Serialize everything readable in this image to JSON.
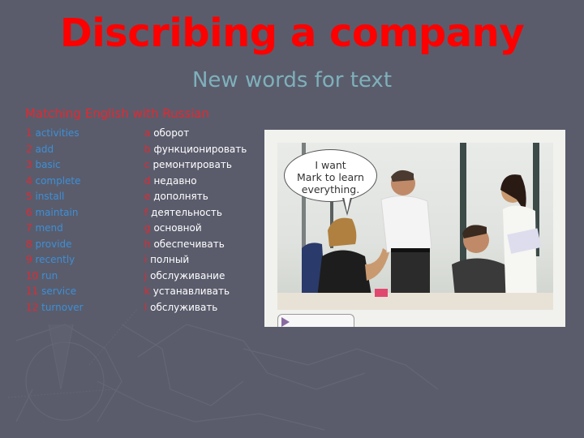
{
  "slide": {
    "title": "Discribing a company",
    "subtitle": "New words for text",
    "section_heading": "Matching English with Russian",
    "colors": {
      "background": "#5a5c6c",
      "title": "#ff0000",
      "subtitle": "#7fb0bb",
      "numbering": "#e8262e",
      "english_words": "#3d8fd6",
      "russian_words": "#ffffff"
    }
  },
  "english_words": [
    {
      "num": "1",
      "word": "activities"
    },
    {
      "num": "2",
      "word": "add"
    },
    {
      "num": "3",
      "word": "basic"
    },
    {
      "num": "4",
      "word": "complete"
    },
    {
      "num": "5",
      "word": "install"
    },
    {
      "num": "6",
      "word": "maintain"
    },
    {
      "num": "7",
      "word": "mend"
    },
    {
      "num": "8",
      "word": "provide"
    },
    {
      "num": "9",
      "word": "recently"
    },
    {
      "num": "10",
      "word": "run"
    },
    {
      "num": "11",
      "word": "service"
    },
    {
      "num": "12",
      "word": "turnover"
    }
  ],
  "russian_words": [
    {
      "letter": "a",
      "word": "оборот"
    },
    {
      "letter": "b",
      "word": "функционировать"
    },
    {
      "letter": "c",
      "word": "ремонтировать"
    },
    {
      "letter": "d",
      "word": "недавно"
    },
    {
      "letter": "e",
      "word": "дополнять"
    },
    {
      "letter": "f",
      "word": "деятельность"
    },
    {
      "letter": "g",
      "word": "основной"
    },
    {
      "letter": "h",
      "word": "обеспечивать"
    },
    {
      "letter": "i",
      "word": "полный"
    },
    {
      "letter": "j",
      "word": "обслуживание"
    },
    {
      "letter": "k",
      "word": "устанавливать"
    },
    {
      "letter": "l",
      "word": "обслуживать"
    }
  ],
  "photo": {
    "speech_bubble_lines": [
      "I want",
      "Mark to learn",
      "everything."
    ],
    "audio_icon": "play-icon"
  }
}
